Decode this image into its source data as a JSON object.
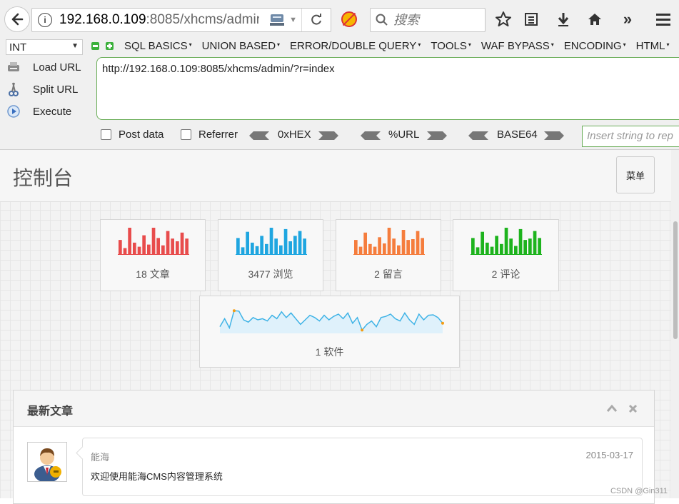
{
  "browser": {
    "url_host": "192.168.0.109",
    "url_rest": ":8085/xhcms/admir",
    "search_placeholder": "搜索"
  },
  "hackbar": {
    "encoding_select": "INT",
    "menus": [
      "SQL BASICS",
      "UNION BASED",
      "ERROR/DOUBLE QUERY",
      "TOOLS",
      "WAF BYPASS",
      "ENCODING",
      "HTML"
    ],
    "load_url": "Load URL",
    "split_url": "Split URL",
    "execute": "Execute",
    "url_value": "http://192.168.0.109:8085/xhcms/admin/?r=index",
    "post_data": "Post data",
    "referrer": "Referrer",
    "hex": "0xHEX",
    "url_enc": "%URL",
    "base64": "BASE64",
    "insert_placeholder": "Insert string to rep"
  },
  "page": {
    "title": "控制台",
    "menu_button": "菜单"
  },
  "stats": [
    {
      "label": "18 文章",
      "color": "#e84c4c",
      "bars": [
        0.55,
        0.25,
        1.0,
        0.45,
        0.3,
        0.72,
        0.38,
        1.0,
        0.62,
        0.35,
        0.88,
        0.6,
        0.5,
        0.82,
        0.6
      ]
    },
    {
      "label": "3477 浏览",
      "color": "#1fa6e0",
      "bars": [
        0.62,
        0.28,
        0.85,
        0.45,
        0.32,
        0.7,
        0.4,
        1.0,
        0.6,
        0.35,
        0.95,
        0.5,
        0.7,
        0.88,
        0.6
      ]
    },
    {
      "label": "2 留言",
      "color": "#f57d3d",
      "bars": [
        0.55,
        0.3,
        0.82,
        0.4,
        0.3,
        0.65,
        0.42,
        1.0,
        0.6,
        0.35,
        0.92,
        0.55,
        0.58,
        0.88,
        0.62
      ]
    },
    {
      "label": "2 评论",
      "color": "#1db31d",
      "bars": [
        0.62,
        0.28,
        0.85,
        0.45,
        0.3,
        0.7,
        0.4,
        1.0,
        0.6,
        0.33,
        0.95,
        0.55,
        0.6,
        0.88,
        0.62
      ]
    }
  ],
  "software": {
    "label": "1 软件",
    "line": [
      0.2,
      0.55,
      0.15,
      0.9,
      0.88,
      0.5,
      0.4,
      0.6,
      0.5,
      0.55,
      0.45,
      0.7,
      0.55,
      0.85,
      0.6,
      0.8,
      0.55,
      0.3,
      0.5,
      0.7,
      0.6,
      0.45,
      0.7,
      0.5,
      0.65,
      0.75,
      0.55,
      0.8,
      0.35,
      0.6,
      0.05,
      0.3,
      0.45,
      0.2,
      0.6,
      0.65,
      0.75,
      0.55,
      0.45,
      0.8,
      0.5,
      0.3,
      0.75,
      0.5,
      0.7,
      0.72,
      0.6,
      0.35
    ],
    "line_color": "#3fb3e6"
  },
  "latest": {
    "title": "最新文章",
    "author": "能海",
    "date": "2015-03-17",
    "text": "欢迎使用能海CMS内容管理系统"
  },
  "watermark": "CSDN @Gin311"
}
